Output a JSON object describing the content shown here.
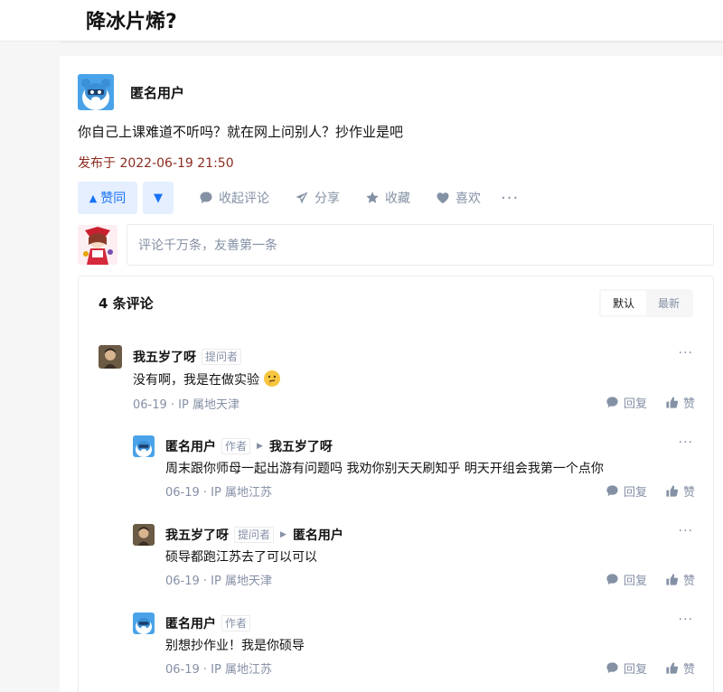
{
  "question": {
    "title": "降冰片烯?"
  },
  "answer": {
    "author": "匿名用户",
    "text": "你自己上课难道不听吗？就在网上问别人？抄作业是吧",
    "published": "发布于 2022-06-19 21:50"
  },
  "actions": {
    "upvote": "赞同",
    "collapse_comments": "收起评论",
    "share": "分享",
    "favorite": "收藏",
    "like": "喜欢",
    "more": "···"
  },
  "comment_input": {
    "placeholder": "评论千万条，友善第一条"
  },
  "comments": {
    "count_label": "4 条评论",
    "sort": {
      "default": "默认",
      "latest": "最新"
    },
    "reply_label": "回复",
    "like_label": "赞",
    "more": "···",
    "items": [
      {
        "author": "我五岁了呀",
        "tag": "提问者",
        "reply_to": "",
        "text": "没有啊，我是在做实验",
        "emoji": "thinking-face",
        "meta": "06-19 · IP 属地天津"
      },
      {
        "author": "匿名用户",
        "tag": "作者",
        "reply_to": "我五岁了呀",
        "text": "周末跟你师母一起出游有问题吗 我劝你别天天刷知乎 明天开组会我第一个点你",
        "meta": "06-19 · IP 属地江苏"
      },
      {
        "author": "我五岁了呀",
        "tag": "提问者",
        "reply_to": "匿名用户",
        "text": "硕导都跑江苏去了可以可以",
        "meta": "06-19 · IP 属地天津"
      },
      {
        "author": "匿名用户",
        "tag": "作者",
        "reply_to": "",
        "text": "别想抄作业！我是你硕导",
        "meta": "06-19 · IP 属地江苏"
      }
    ]
  },
  "colors": {
    "accent": "#1772f6",
    "accent_bg": "#e5efff",
    "time": "#8c2b1f",
    "muted": "#8590a6"
  }
}
